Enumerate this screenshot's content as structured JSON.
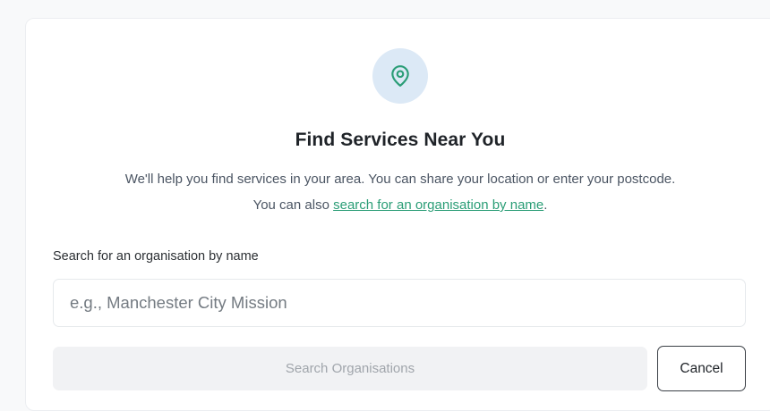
{
  "header": {
    "icon": "location-pin-icon",
    "title": "Find Services Near You",
    "description_line1": "We'll help you find services in your area. You can share your location or enter your postcode.",
    "description_prefix": "You can also ",
    "description_link": "search for an organisation by name",
    "description_suffix": "."
  },
  "search": {
    "label": "Search for an organisation by name",
    "value": "",
    "placeholder": "e.g., Manchester City Mission",
    "submit_label": "Search Organisations",
    "cancel_label": "Cancel"
  },
  "colors": {
    "accent": "#2a9d76",
    "icon_bg": "#dce9f6",
    "disabled_bg": "#f1f2f4"
  }
}
